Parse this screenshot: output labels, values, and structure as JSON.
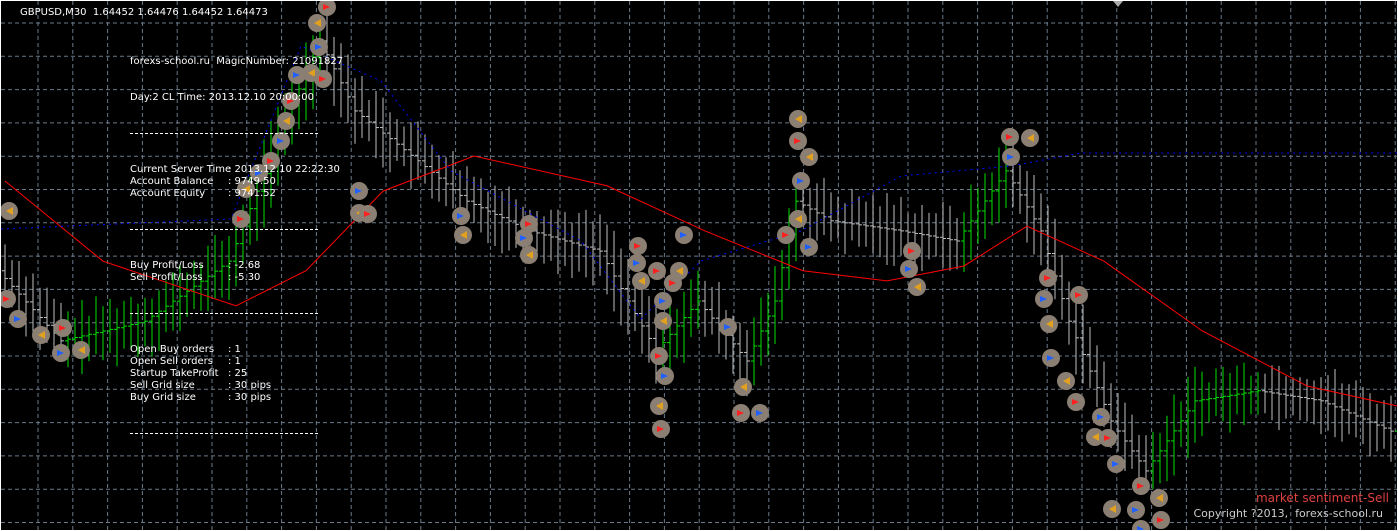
{
  "header": {
    "symbol_line": "GBPUSD,M30  1.64452 1.64476 1.64452 1.64473"
  },
  "panel": {
    "line1": "forexs-school.ru  MagicNumber: 21091827",
    "line2": "Day:2 CL Time: 2013.12.10 20:00:00",
    "rows_a": [
      {
        "label": "Current Server Time",
        "value": ": 2013.12.10 22:22:30"
      },
      {
        "label": "Account Balance",
        "value": ": 9749.50"
      },
      {
        "label": "Account Equity",
        "value": ": 9741.52"
      }
    ],
    "rows_b": [
      {
        "label": "Buy Profit/Loss",
        "value": ": -2.68"
      },
      {
        "label": "Sell Profit/Loss",
        "value": ": -5.30"
      }
    ],
    "rows_c": [
      {
        "label": "Open Buy orders",
        "value": ": 1"
      },
      {
        "label": "Open Sell orders",
        "value": ": 1"
      },
      {
        "label": "Startup TakeProfit",
        "value": ": 25"
      },
      {
        "label": "Sell Grid size",
        "value": ": 30 pips"
      },
      {
        "label": "Buy Grid size",
        "value": ": 30 pips"
      }
    ]
  },
  "footer": {
    "sentiment": "market sentiment-Sell",
    "copyright": "Copyright ?2013,  forexs-school.ru"
  },
  "colors": {
    "bg": "#000000",
    "grid": "#6a7a8a",
    "bull": "#00e000",
    "bear": "#c0c0c0",
    "ma": "#ff0000",
    "trail": "#0000ff"
  },
  "chart_data": {
    "type": "line",
    "price_range": [
      1.64,
      1.65
    ],
    "price_path": [
      [
        0,
        1.64492
      ],
      [
        9,
        1.6436
      ],
      [
        21,
        1.64397
      ],
      [
        33,
        1.6451
      ],
      [
        41,
        1.64774
      ],
      [
        46,
        1.64925
      ],
      [
        51,
        1.64793
      ],
      [
        60,
        1.64699
      ],
      [
        67,
        1.64623
      ],
      [
        76,
        1.64567
      ],
      [
        86,
        1.64529
      ],
      [
        94,
        1.64341
      ],
      [
        100,
        1.64435
      ],
      [
        107,
        1.64322
      ],
      [
        111,
        1.64435
      ],
      [
        114,
        1.64623
      ],
      [
        119,
        1.64586
      ],
      [
        129,
        1.64567
      ],
      [
        137,
        1.64548
      ],
      [
        144,
        1.6468
      ],
      [
        149,
        1.64567
      ],
      [
        153,
        1.64397
      ],
      [
        159,
        1.64209
      ],
      [
        164,
        1.64115
      ],
      [
        171,
        1.64247
      ],
      [
        180,
        1.64266
      ],
      [
        189,
        1.64247
      ],
      [
        199,
        1.6419
      ]
    ],
    "ma_path": [
      [
        0,
        1.64661
      ],
      [
        14,
        1.6451
      ],
      [
        33,
        1.64426
      ],
      [
        43,
        1.64492
      ],
      [
        54,
        1.64642
      ],
      [
        67,
        1.64708
      ],
      [
        86,
        1.64652
      ],
      [
        100,
        1.64567
      ],
      [
        114,
        1.64492
      ],
      [
        126,
        1.64473
      ],
      [
        137,
        1.64501
      ],
      [
        146,
        1.64576
      ],
      [
        157,
        1.6451
      ],
      [
        171,
        1.64379
      ],
      [
        186,
        1.64275
      ],
      [
        199,
        1.64237
      ]
    ]
  }
}
